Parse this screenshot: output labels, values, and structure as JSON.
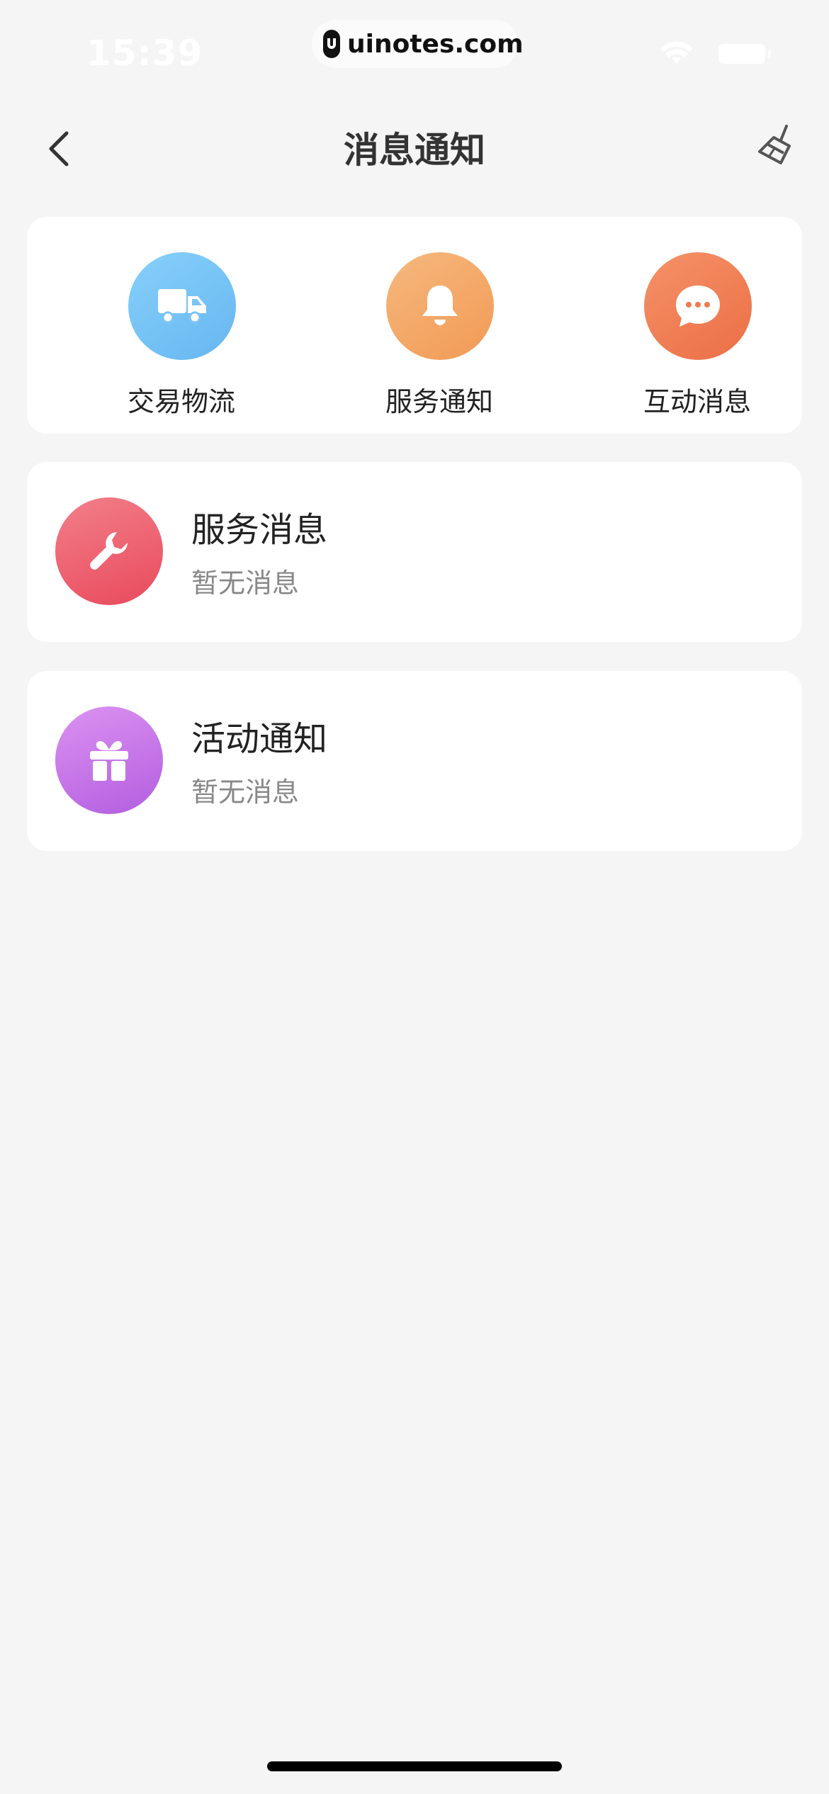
{
  "status": {
    "time": "15:39",
    "watermark": "uinotes.com"
  },
  "nav": {
    "title": "消息通知",
    "back_icon": "chevron-left-icon",
    "clean_icon": "broom-icon"
  },
  "quick_actions": [
    {
      "label": "交易物流",
      "icon": "truck-icon",
      "color": "#6fbcf2"
    },
    {
      "label": "服务通知",
      "icon": "bell-icon",
      "color": "#f3a262"
    },
    {
      "label": "互动消息",
      "icon": "chat-bubble-icon",
      "color": "#ee7a50"
    }
  ],
  "messages": [
    {
      "title": "服务消息",
      "subtitle": "暂无消息",
      "icon": "wrench-icon",
      "color": "#ec5a69"
    },
    {
      "title": "活动通知",
      "subtitle": "暂无消息",
      "icon": "gift-icon",
      "color": "#c274e6"
    }
  ]
}
